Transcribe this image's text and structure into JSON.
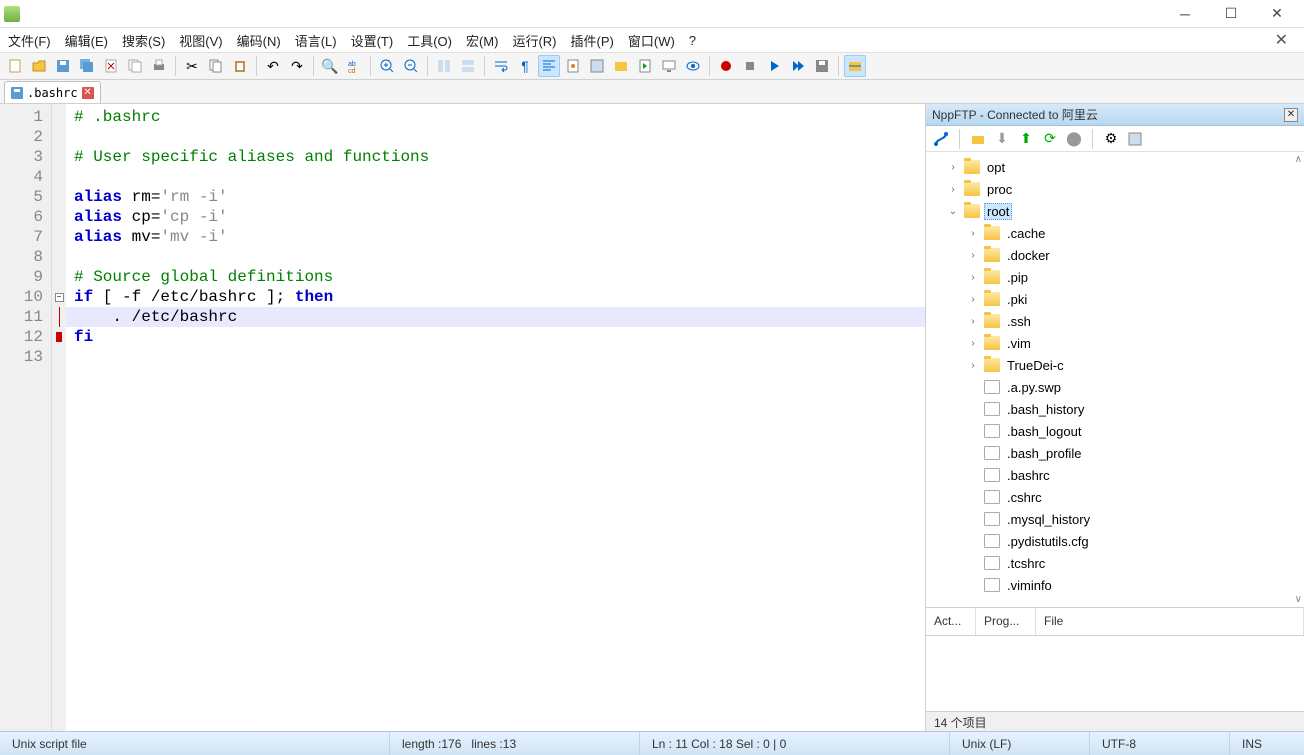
{
  "window": {
    "title": ""
  },
  "menus": [
    "文件(F)",
    "编辑(E)",
    "搜索(S)",
    "视图(V)",
    "编码(N)",
    "语言(L)",
    "设置(T)",
    "工具(O)",
    "宏(M)",
    "运行(R)",
    "插件(P)",
    "窗口(W)",
    "?"
  ],
  "tab": {
    "name": ".bashrc"
  },
  "code": {
    "lines": [
      {
        "n": 1,
        "t": "comment",
        "text": "# .bashrc"
      },
      {
        "n": 2,
        "t": "blank",
        "text": ""
      },
      {
        "n": 3,
        "t": "comment",
        "text": "# User specific aliases and functions"
      },
      {
        "n": 4,
        "t": "blank",
        "text": ""
      },
      {
        "n": 5,
        "t": "alias",
        "kw": "alias",
        "rest": " rm=",
        "str": "'rm -i'"
      },
      {
        "n": 6,
        "t": "alias",
        "kw": "alias",
        "rest": " cp=",
        "str": "'cp -i'"
      },
      {
        "n": 7,
        "t": "alias",
        "kw": "alias",
        "rest": " mv=",
        "str": "'mv -i'"
      },
      {
        "n": 8,
        "t": "blank",
        "text": ""
      },
      {
        "n": 9,
        "t": "comment",
        "text": "# Source global definitions"
      },
      {
        "n": 10,
        "t": "if",
        "kw1": "if",
        "mid": " [ -f /etc/bashrc ]; ",
        "kw2": "then"
      },
      {
        "n": 11,
        "t": "plain",
        "text": "    . /etc/bashrc",
        "hl": true
      },
      {
        "n": 12,
        "t": "kw",
        "kw": "fi"
      },
      {
        "n": 13,
        "t": "blank",
        "text": ""
      }
    ]
  },
  "ftp": {
    "title": "NppFTP - Connected to 阿里云",
    "tree": [
      {
        "depth": 1,
        "type": "folder",
        "name": "opt",
        "arrow": ">"
      },
      {
        "depth": 1,
        "type": "folder",
        "name": "proc",
        "arrow": ">"
      },
      {
        "depth": 1,
        "type": "folder",
        "name": "root",
        "arrow": "v",
        "selected": true
      },
      {
        "depth": 2,
        "type": "folder",
        "name": ".cache",
        "arrow": ">"
      },
      {
        "depth": 2,
        "type": "folder",
        "name": ".docker",
        "arrow": ">"
      },
      {
        "depth": 2,
        "type": "folder",
        "name": ".pip",
        "arrow": ">"
      },
      {
        "depth": 2,
        "type": "folder",
        "name": ".pki",
        "arrow": ">"
      },
      {
        "depth": 2,
        "type": "folder",
        "name": ".ssh",
        "arrow": ">"
      },
      {
        "depth": 2,
        "type": "folder",
        "name": ".vim",
        "arrow": ">"
      },
      {
        "depth": 2,
        "type": "folder",
        "name": "TrueDei-c",
        "arrow": ">"
      },
      {
        "depth": 2,
        "type": "file",
        "name": ".a.py.swp"
      },
      {
        "depth": 2,
        "type": "file",
        "name": ".bash_history"
      },
      {
        "depth": 2,
        "type": "file",
        "name": ".bash_logout"
      },
      {
        "depth": 2,
        "type": "file",
        "name": ".bash_profile"
      },
      {
        "depth": 2,
        "type": "file",
        "name": ".bashrc"
      },
      {
        "depth": 2,
        "type": "file",
        "name": ".cshrc"
      },
      {
        "depth": 2,
        "type": "file",
        "name": ".mysql_history"
      },
      {
        "depth": 2,
        "type": "file",
        "name": ".pydistutils.cfg"
      },
      {
        "depth": 2,
        "type": "file",
        "name": ".tcshrc"
      },
      {
        "depth": 2,
        "type": "file",
        "name": ".viminfo"
      }
    ],
    "columns": [
      "Act...",
      "Prog...",
      "File"
    ],
    "status": "14 个项目"
  },
  "status": {
    "filetype": "Unix script file",
    "length_label": "length : ",
    "length": "176",
    "lines_label": "lines : ",
    "lines": "13",
    "pos": "Ln : 11   Col : 18   Sel : 0 | 0",
    "eol": "Unix (LF)",
    "encoding": "UTF-8",
    "mode": "INS"
  },
  "icons": {
    "minimize": "─",
    "maximize": "☐",
    "close": "✕"
  }
}
